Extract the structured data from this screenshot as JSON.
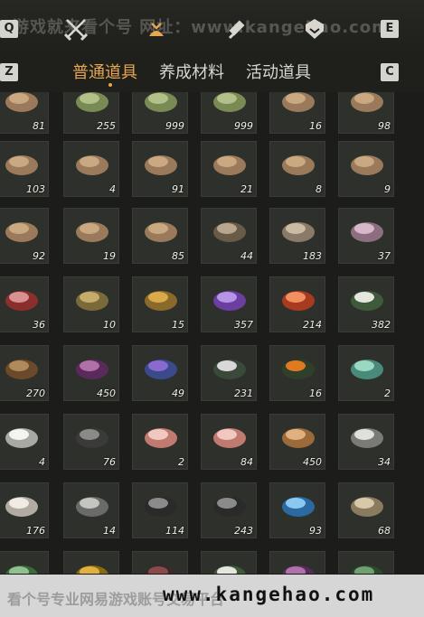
{
  "header": {
    "key_q": "Q",
    "key_e": "E",
    "key_z": "Z",
    "key_c": "C",
    "watermark": "游戏就来看个号 网址：www.kangehao.com"
  },
  "tabs": [
    {
      "label": "普通道具",
      "active": true
    },
    {
      "label": "养成材料",
      "active": false
    },
    {
      "label": "活动道具",
      "active": false
    }
  ],
  "items": [
    [
      {
        "icon": "wood-log-icon",
        "qty": "81"
      },
      {
        "icon": "bamboo-icon",
        "qty": "255"
      },
      {
        "icon": "bamboo-icon",
        "qty": "999"
      },
      {
        "icon": "bamboo-icon",
        "qty": "999"
      },
      {
        "icon": "wood-log-icon",
        "qty": "16"
      },
      {
        "icon": "wood-log-icon",
        "qty": "98"
      }
    ],
    [
      {
        "icon": "wood-log-icon",
        "qty": "103"
      },
      {
        "icon": "wood-log-icon",
        "qty": "4"
      },
      {
        "icon": "wood-log-icon",
        "qty": "91"
      },
      {
        "icon": "wood-log-icon",
        "qty": "21"
      },
      {
        "icon": "wood-log-icon",
        "qty": "8"
      },
      {
        "icon": "wood-log-icon",
        "qty": "9"
      }
    ],
    [
      {
        "icon": "wood-log-icon",
        "qty": "92"
      },
      {
        "icon": "wood-log-icon",
        "qty": "19"
      },
      {
        "icon": "wood-log-icon",
        "qty": "85"
      },
      {
        "icon": "feather-bundle-icon",
        "qty": "44"
      },
      {
        "icon": "hide-icon",
        "qty": "183"
      },
      {
        "icon": "tentacle-icon",
        "qty": "37"
      }
    ],
    [
      {
        "icon": "meat-icon",
        "qty": "36"
      },
      {
        "icon": "fish-icon",
        "qty": "10"
      },
      {
        "icon": "ore-gold-icon",
        "qty": "15"
      },
      {
        "icon": "amethyst-icon",
        "qty": "357"
      },
      {
        "icon": "red-stone-icon",
        "qty": "214"
      },
      {
        "icon": "white-flower-icon",
        "qty": "382"
      }
    ],
    [
      {
        "icon": "mortar-bowl-icon",
        "qty": "270"
      },
      {
        "icon": "purple-flower-icon",
        "qty": "450"
      },
      {
        "icon": "lavender-icon",
        "qty": "49"
      },
      {
        "icon": "small-white-flower-icon",
        "qty": "231"
      },
      {
        "icon": "orange-flower-icon",
        "qty": "16"
      },
      {
        "icon": "jade-icon",
        "qty": "2"
      }
    ],
    [
      {
        "icon": "white-feather-icon",
        "qty": "4"
      },
      {
        "icon": "dark-feather-icon",
        "qty": "76"
      },
      {
        "icon": "raw-meat-icon",
        "qty": "2"
      },
      {
        "icon": "raw-meat-icon",
        "qty": "84"
      },
      {
        "icon": "fur-icon",
        "qty": "450"
      },
      {
        "icon": "quill-icon",
        "qty": "34"
      }
    ],
    [
      {
        "icon": "wool-icon",
        "qty": "176"
      },
      {
        "icon": "silver-fish-icon",
        "qty": "14"
      },
      {
        "icon": "coal-icon",
        "qty": "114"
      },
      {
        "icon": "coal-icon",
        "qty": "243"
      },
      {
        "icon": "blue-crystal-icon",
        "qty": "93"
      },
      {
        "icon": "bone-icon",
        "qty": "68"
      }
    ],
    [
      {
        "icon": "green-fruit-icon",
        "qty": ""
      },
      {
        "icon": "gold-item-icon",
        "qty": ""
      },
      {
        "icon": "dark-plant-icon",
        "qty": ""
      },
      {
        "icon": "white-flower-icon",
        "qty": ""
      },
      {
        "icon": "purple-flower-icon",
        "qty": ""
      },
      {
        "icon": "herb-icon",
        "qty": ""
      }
    ]
  ],
  "footer": {
    "text_left": "看个号专业网易游戏账号交易平台",
    "url": "www.kangehao.com"
  }
}
